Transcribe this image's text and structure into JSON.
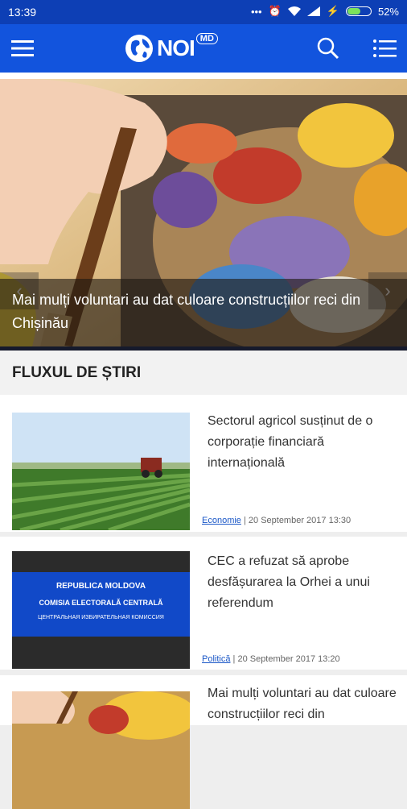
{
  "status_bar": {
    "time": "13:39",
    "battery": "52%",
    "battery_level": 0.52
  },
  "header": {
    "logo_text": "NOI",
    "logo_badge": "MD"
  },
  "hero": {
    "caption": "Mai mulți voluntari au dat culoare construcțiilor reci din Chișinău"
  },
  "section": {
    "title": "FLUXUL DE ȘTIRI"
  },
  "news": [
    {
      "title": "Sectorul agricol susținut de o corporație financiară internațională",
      "category": "Economie",
      "date": "| 20 September 2017 13:30"
    },
    {
      "title": "CEC a refuzat să aprobe desfășurarea la Orhei a unui referendum",
      "category": "Politică",
      "date": "| 20 September 2017 13:20",
      "image_text": [
        "REPUBLICA MOLDOVA",
        "COMISIA ELECTORALĂ CENTRALĂ",
        "ЦЕНТРАЛЬНАЯ ИЗБИРАТЕЛЬНАЯ КОМИССИЯ"
      ]
    },
    {
      "title": "Mai mulți voluntari au dat culoare construcțiilor reci din"
    }
  ],
  "colors": {
    "status_bar": "#0d3fb5",
    "app_bar": "#1254dd",
    "link": "#1a57c7"
  },
  "icons": [
    "menu-icon",
    "globe-icon",
    "search-icon",
    "list-icon",
    "chevron-left-icon",
    "chevron-right-icon"
  ]
}
